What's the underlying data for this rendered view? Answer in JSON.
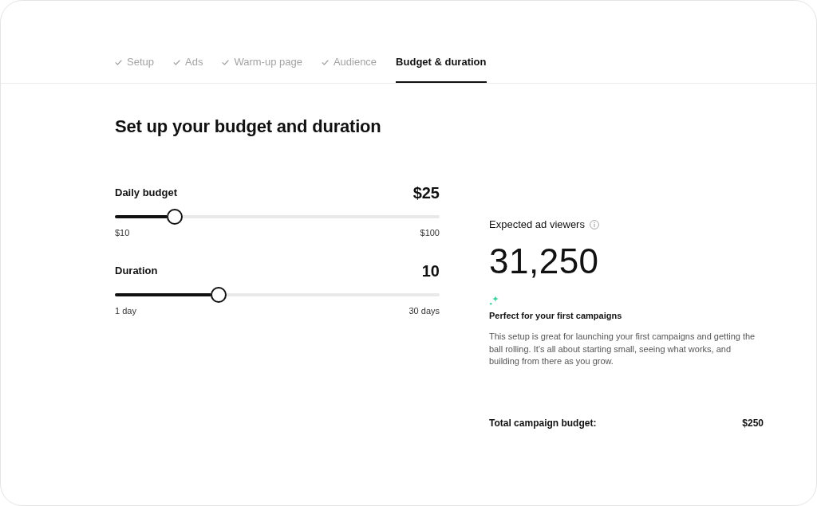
{
  "steps": [
    {
      "label": "Setup",
      "completed": true,
      "selected": false
    },
    {
      "label": "Ads",
      "completed": true,
      "selected": false
    },
    {
      "label": "Warm-up page",
      "completed": true,
      "selected": false
    },
    {
      "label": "Audience",
      "completed": true,
      "selected": false
    },
    {
      "label": "Budget & duration",
      "completed": false,
      "selected": true
    }
  ],
  "heading": "Set up your budget and duration",
  "sliders": [
    {
      "label": "Daily budget",
      "value": "$25",
      "level": 0.167,
      "min_label": "$10",
      "max_label": "$100"
    },
    {
      "label": "Duration",
      "value": "10",
      "level": 0.31,
      "min_label": "1 day",
      "max_label": "30 days"
    }
  ],
  "estimate": {
    "label": "Expected ad viewers",
    "value": "31,250",
    "note": {
      "title": "Perfect for your first campaigns",
      "text": "This setup is great for launching your first campaigns and getting the ball rolling. It’s all about starting small, seeing what works, and building from there as you grow."
    }
  },
  "total": {
    "label": "Total campaign budget:",
    "value": "$250"
  }
}
